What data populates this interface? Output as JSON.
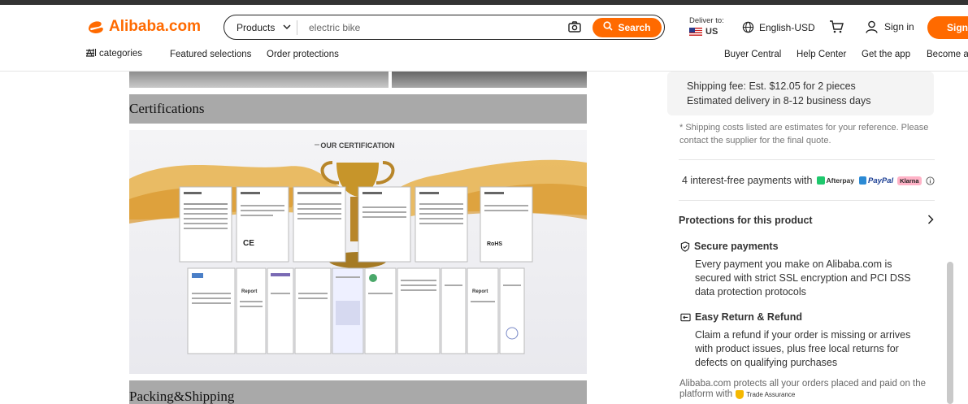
{
  "header": {
    "logo_text": "Alibaba.com",
    "search": {
      "category_label": "Products",
      "query": "electric bike",
      "button_label": "Search"
    },
    "deliver_to_label": "Deliver to:",
    "deliver_country": "US",
    "language_currency": "English-USD",
    "signin_label": "Sign in",
    "signup_label": "Sign up"
  },
  "nav": {
    "all_categories": "All categories",
    "featured": "Featured selections",
    "order_protections": "Order protections",
    "buyer_central": "Buyer Central",
    "help_center": "Help Center",
    "get_app": "Get the app",
    "become_supplier": "Become a supplier"
  },
  "main": {
    "certifications_heading": "Certifications",
    "certificate_banner_title": "OUR CERTIFICATION",
    "packing_heading": "Packing&Shipping",
    "cert_labels": {
      "ce": "CE",
      "rohs": "RoHS",
      "report": "Report",
      "cert": "CERTIFICATE"
    }
  },
  "sidebar": {
    "shipping_fee": "Shipping fee: Est. $12.05 for 2 pieces",
    "estimated_delivery": "Estimated delivery in 8-12 business days",
    "shipping_note_1": "* Shipping costs listed are estimates for your reference. Please",
    "shipping_note_2": "contact the supplier for the final quote.",
    "installments": "4 interest-free payments with",
    "afterpay": "Afterpay",
    "paypal": "PayPal",
    "klarna": "Klarna",
    "protections_title": "Protections for this product",
    "secure_title": "Secure payments",
    "secure_desc_1": "Every payment you make on Alibaba.com is",
    "secure_desc_2": "secured with strict SSL encryption and PCI DSS",
    "secure_desc_3": "data protection protocols",
    "return_title": "Easy Return & Refund",
    "return_desc_1": "Claim a refund if your order is missing or arrives",
    "return_desc_2": "with product issues, plus free local returns for",
    "return_desc_3": "defects on qualifying purchases",
    "assurance_1": "Alibaba.com protects all your orders placed and paid on the",
    "assurance_2": "platform with",
    "trade_assurance": "Trade Assurance"
  },
  "colors": {
    "brand": "#ff6a00",
    "section_bg": "#a9a9a9"
  }
}
